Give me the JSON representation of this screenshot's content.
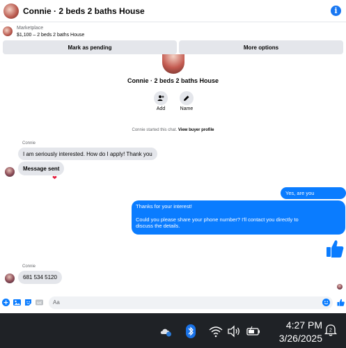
{
  "header": {
    "title": "Connie · 2 beds 2 baths House"
  },
  "marketplace": {
    "label": "Marketplace",
    "listing": "$1,100 – 2 beds 2 baths House",
    "pending_button": "Mark as pending",
    "more_button": "More options"
  },
  "profile": {
    "name": "Connie · 2 beds 2 baths House",
    "actions": [
      {
        "label": "Add"
      },
      {
        "label": "Name"
      }
    ]
  },
  "system_message": {
    "text": "Connie started this chat.",
    "link": "View buyer profile"
  },
  "messages": [
    {
      "sender": "Connie",
      "text": "I am seriously interested. How do I apply! Thank you"
    },
    {
      "text": "Message sent",
      "reaction": "heart"
    },
    {
      "text": "Yes, are you interested?",
      "outgoing": true
    },
    {
      "lines": [
        "Thanks for your interest!",
        "",
        "Could you please share your phone number? I'll contact you directly to",
        "discuss the details."
      ],
      "outgoing": true
    },
    {
      "sender": "Connie",
      "text": "681 534 5120"
    }
  ],
  "composer": {
    "placeholder": "Aa"
  },
  "taskbar": {
    "time": "4:27 PM",
    "date": "3/26/2025",
    "notification_count": "2"
  },
  "colors": {
    "accent": "#0a7cff",
    "bubble_in": "#e4e6eb",
    "taskbar": "#1f2226"
  },
  "icons": [
    "info-icon",
    "add-person-icon",
    "pencil-icon",
    "thumbs-up-icon",
    "plus-circle-icon",
    "image-icon",
    "sticker-icon",
    "gif-icon",
    "emoji-icon",
    "cloud-icon",
    "bluetooth-icon",
    "wifi-icon",
    "volume-icon",
    "battery-icon",
    "bell-icon"
  ]
}
